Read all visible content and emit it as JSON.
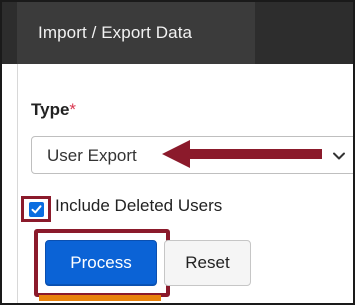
{
  "header": {
    "tab_label": "Import / Export Data"
  },
  "form": {
    "type_label": "Type",
    "required_mark": "*",
    "type_select": {
      "selected_value": "User Export"
    },
    "include_deleted": {
      "label": "Include Deleted Users",
      "checked": true
    },
    "buttons": {
      "process_label": "Process",
      "reset_label": "Reset"
    }
  },
  "colors": {
    "header_bg": "#2d2d2d",
    "tab_bg": "#3b3b3b",
    "primary_button": "#0b63d6",
    "annotation": "#8b1a2b",
    "accent_orange": "#e8820c"
  },
  "icons": {
    "select_chevron": "chevron-down-icon",
    "checkbox_mark": "checkmark-icon",
    "annotation_arrow": "left-arrow-icon"
  }
}
